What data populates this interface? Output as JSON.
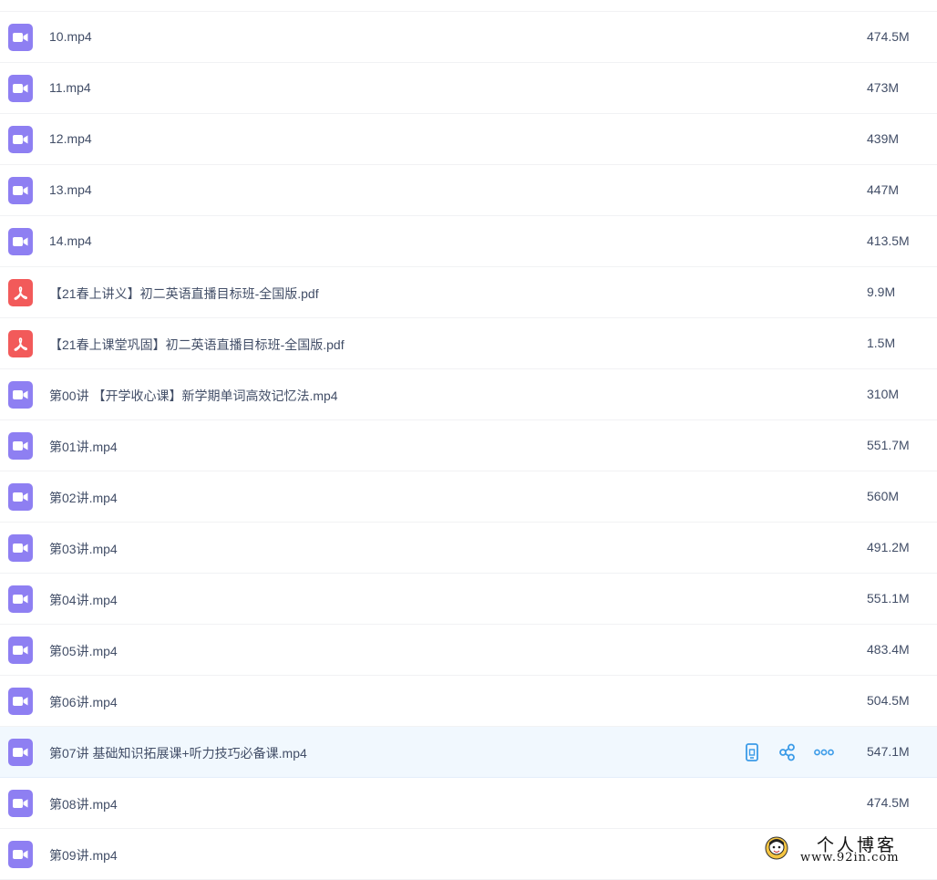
{
  "files": [
    {
      "name": "10.mp4",
      "size": "474.5M",
      "type": "video"
    },
    {
      "name": "11.mp4",
      "size": "473M",
      "type": "video"
    },
    {
      "name": "12.mp4",
      "size": "439M",
      "type": "video"
    },
    {
      "name": "13.mp4",
      "size": "447M",
      "type": "video"
    },
    {
      "name": "14.mp4",
      "size": "413.5M",
      "type": "video"
    },
    {
      "name": "【21春上讲义】初二英语直播目标班-全国版.pdf",
      "size": "9.9M",
      "type": "pdf"
    },
    {
      "name": "【21春上课堂巩固】初二英语直播目标班-全国版.pdf",
      "size": "1.5M",
      "type": "pdf"
    },
    {
      "name": "第00讲 【开学收心课】新学期单词高效记忆法.mp4",
      "size": "310M",
      "type": "video"
    },
    {
      "name": "第01讲.mp4",
      "size": "551.7M",
      "type": "video"
    },
    {
      "name": "第02讲.mp4",
      "size": "560M",
      "type": "video"
    },
    {
      "name": "第03讲.mp4",
      "size": "491.2M",
      "type": "video"
    },
    {
      "name": "第04讲.mp4",
      "size": "551.1M",
      "type": "video"
    },
    {
      "name": "第05讲.mp4",
      "size": "483.4M",
      "type": "video"
    },
    {
      "name": "第06讲.mp4",
      "size": "504.5M",
      "type": "video"
    },
    {
      "name": "第07讲 基础知识拓展课+听力技巧必备课.mp4",
      "size": "547.1M",
      "type": "video",
      "hovered": true
    },
    {
      "name": "第08讲.mp4",
      "size": "474.5M",
      "type": "video"
    },
    {
      "name": "第09讲.mp4",
      "size": "",
      "type": "video"
    }
  ],
  "row_actions": [
    {
      "icon": "phone-icon"
    },
    {
      "icon": "share-icon"
    },
    {
      "icon": "more-icon"
    }
  ],
  "watermark": {
    "title": "个人博客",
    "url": "www.92in.com"
  },
  "colors": {
    "video_icon": "#8e7ff2",
    "pdf_icon": "#f25a5a",
    "action_icon": "#3b9be8",
    "hover_row": "#f1f8fe"
  }
}
